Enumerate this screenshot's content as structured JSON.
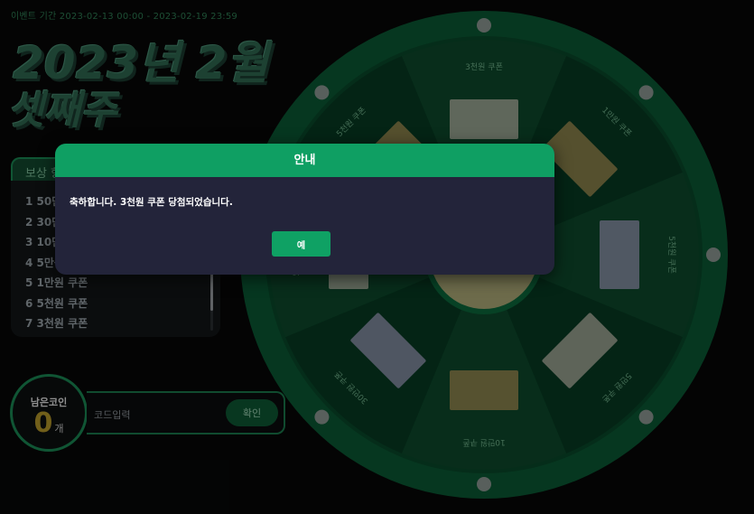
{
  "event": {
    "period": "이벤트 기간 2023-02-13 00:00 - 2023-02-19 23:59",
    "title_line1": "2023년 2월",
    "title_line2": "셋째주"
  },
  "rewards": {
    "tab_label": "보상 항",
    "items": [
      "1 50만",
      "2 30만",
      "3 10만",
      "4 5만원",
      "5 1만원 쿠폰",
      "6 5천원 쿠폰",
      "7 3천원 쿠폰"
    ]
  },
  "coins": {
    "label": "남은코인",
    "value": "0",
    "unit": "개"
  },
  "code": {
    "placeholder": "코드입력",
    "confirm_label": "확인"
  },
  "wheel": {
    "segments": [
      "3천원 쿠폰",
      "1만원 쿠폰",
      "5천원 쿠폰",
      "5만원 쿠폰",
      "10만원 쿠폰",
      "30만원 쿠폰",
      "50만원 쿠폰",
      "5천원 쿠폰"
    ],
    "colors": {
      "rim": "#0b5a34",
      "light": "#0d4a2c",
      "dark": "#073a22"
    }
  },
  "modal": {
    "title": "안내",
    "message": "축하합니다. 3천원 쿠폰 당첨되었습니다.",
    "ok_label": "예"
  }
}
